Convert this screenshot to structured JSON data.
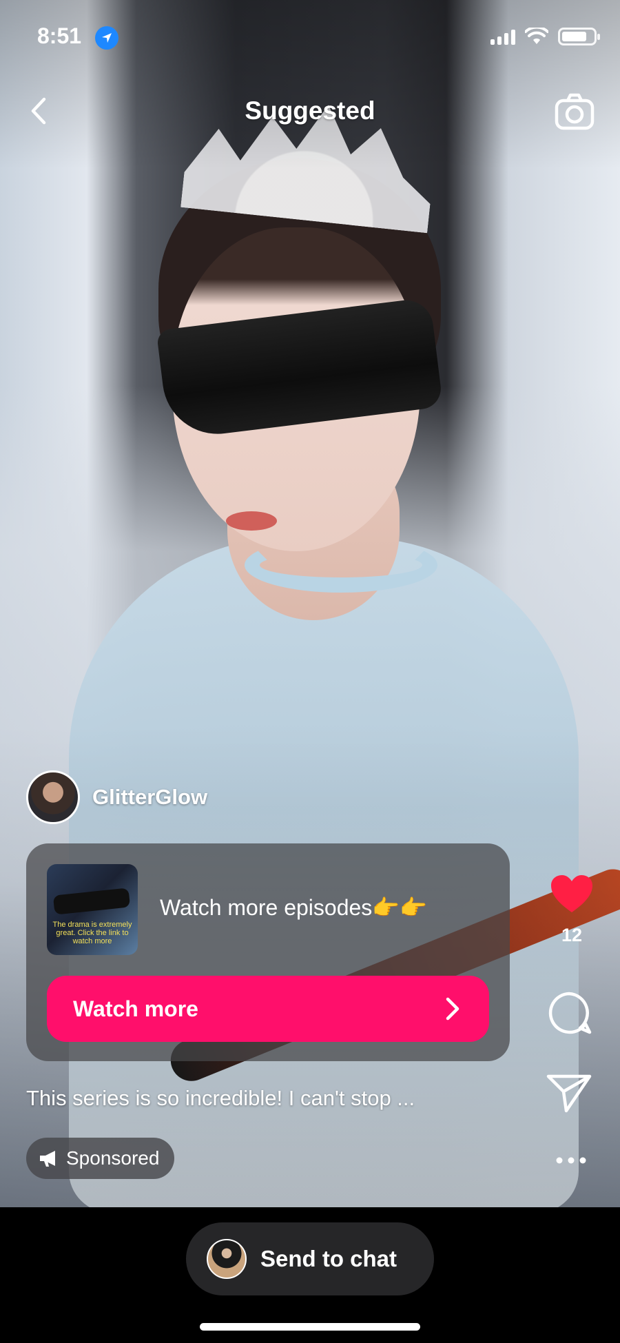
{
  "status_bar": {
    "time": "8:51"
  },
  "header": {
    "title": "Suggested"
  },
  "post": {
    "username": "GlitterGlow",
    "promo": {
      "text": "Watch more episodes👉👉",
      "button_label": "Watch more",
      "thumbnail_caption": "The drama is extremely great. Click the link to watch more"
    },
    "caption": "This series is so incredible! I can't stop ...",
    "sponsored_label": "Sponsored"
  },
  "actions": {
    "like_count": "12",
    "like_color": "#ff1f44"
  },
  "bottom_bar": {
    "send_label": "Send to chat"
  },
  "colors": {
    "accent": "#ff0f6b"
  },
  "icons": [
    "back-chevron-icon",
    "camera-icon",
    "heart-icon",
    "comment-icon",
    "send-icon",
    "more-icon",
    "megaphone-icon",
    "location-arrow-icon",
    "signal-icon",
    "wifi-icon",
    "battery-icon"
  ]
}
